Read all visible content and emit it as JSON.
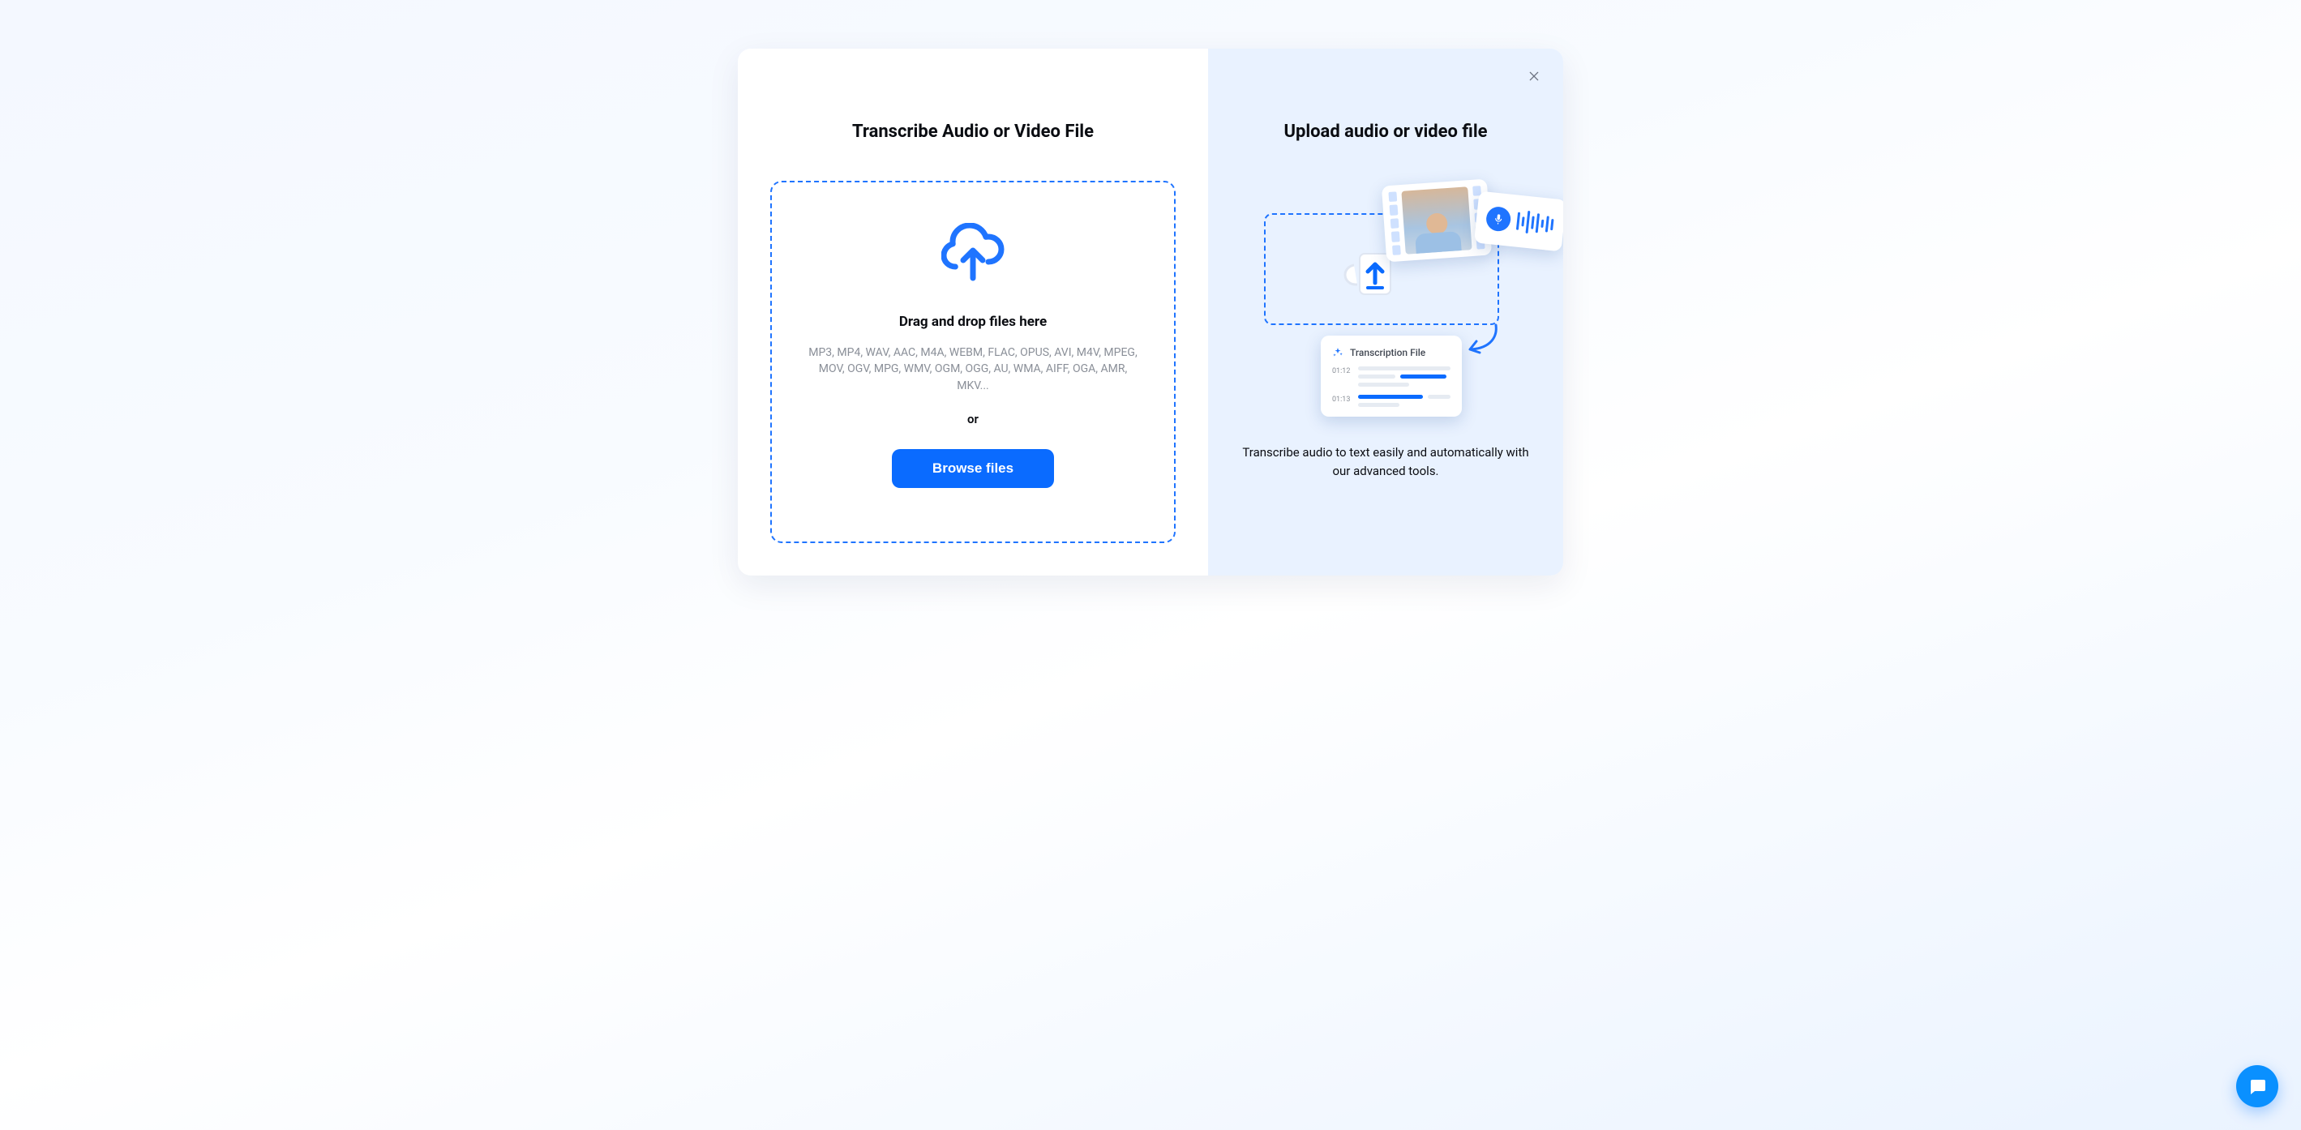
{
  "left": {
    "title": "Transcribe Audio or Video File",
    "dropzone": {
      "heading": "Drag and drop files here",
      "formats": "MP3, MP4, WAV, AAC, M4A, WEBM, FLAC, OPUS, AVI, M4V, MPEG, MOV, OGV, MPG, WMV, OGM, OGG, AU, WMA, AIFF, OGA, AMR, MKV...",
      "or": "or",
      "browse_label": "Browse files"
    }
  },
  "right": {
    "title": "Upload audio or video file",
    "description": "Transcribe audio to text easily and automatically with our advanced tools.",
    "transcription_card": {
      "title": "Transcription File",
      "row1_time": "01:12",
      "row2_time": "01:13"
    }
  },
  "colors": {
    "accent": "#0a6bff",
    "accent_light": "#1f74ff",
    "panel": "#e9f2ff"
  }
}
